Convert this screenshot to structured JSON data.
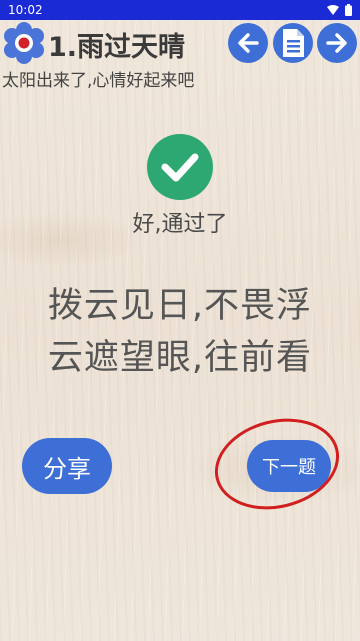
{
  "status_bar": {
    "time": "10:02"
  },
  "header": {
    "title": "1.雨过天晴",
    "back_icon": "arrow-left-icon",
    "list_icon": "document-list-icon",
    "forward_icon": "arrow-right-icon",
    "accent": "#3d6fd6"
  },
  "subtitle": "太阳出来了,心情好起来吧",
  "result": {
    "icon": "checkmark-icon",
    "color": "#2ea872",
    "text": "好,通过了"
  },
  "verse": {
    "line1": "拨云见日,不畏浮",
    "line2": "云遮望眼,往前看"
  },
  "actions": {
    "share_label": "分享",
    "next_label": "下一题",
    "highlight_color": "#d11f1f"
  }
}
